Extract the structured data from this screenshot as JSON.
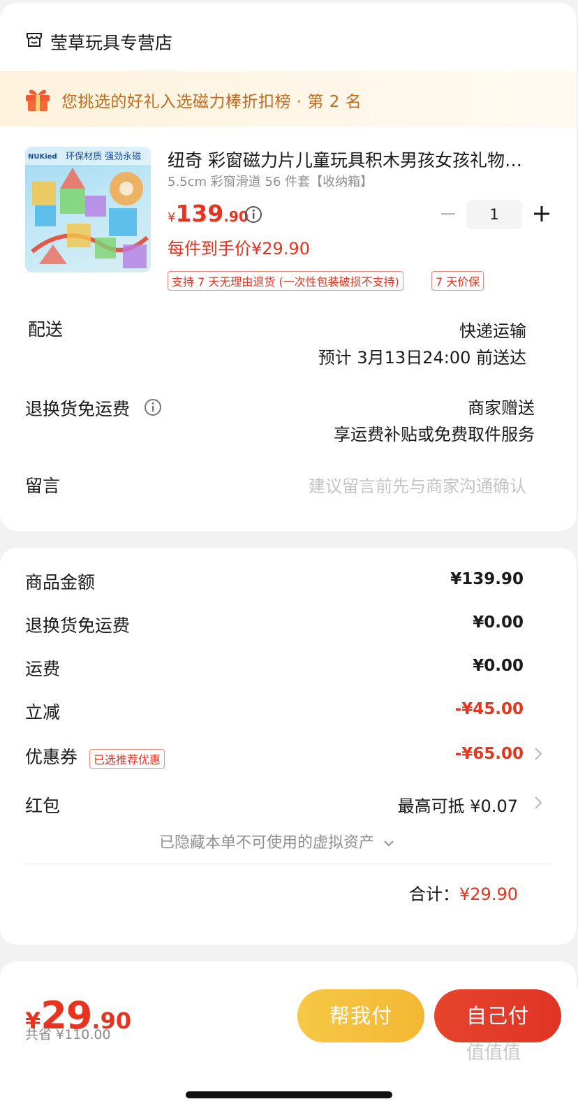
{
  "store": {
    "name": "莹草玩具专营店",
    "icon": "store-icon"
  },
  "rank_banner": {
    "text": "您挑选的好礼入选磁力棒折扣榜 · 第 2 名",
    "icon": "gift-icon"
  },
  "product": {
    "image_badge": "环保材质 强劲永磁",
    "image_logo": "NUKied",
    "title": "纽奇 彩窗磁力片儿童玩具积木男孩女孩礼物…",
    "spec": "5.5cm 彩窗滑道 56 件套【收纳箱】",
    "price_symbol": "¥",
    "price_int": "139",
    "price_dec": ".90",
    "quantity": "1",
    "deal_price": "每件到手价¥29.90",
    "tags": [
      "支持 7 天无理由退货 (一次性包装破损不支持)",
      "7 天价保"
    ]
  },
  "delivery": {
    "label": "配送",
    "method": "快递运输",
    "eta": "预计 3月13日24:00 前送达"
  },
  "return_shipping": {
    "label": "退换货免运费",
    "value": "商家赠送",
    "sub": "享运费补贴或免费取件服务"
  },
  "message": {
    "label": "留言",
    "placeholder": "建议留言前先与商家沟通确认"
  },
  "summary": {
    "goods": {
      "label": "商品金额",
      "value": "¥139.90"
    },
    "return_fee": {
      "label": "退换货免运费",
      "value": "¥0.00"
    },
    "shipping": {
      "label": "运费",
      "value": "¥0.00"
    },
    "discount": {
      "label": "立减",
      "value": "-¥45.00"
    },
    "coupon": {
      "label": "优惠券",
      "tag": "已选推荐优惠",
      "value": "-¥65.00"
    },
    "redpacket": {
      "label": "红包",
      "value": "最高可抵 ¥0.07"
    },
    "hidden_assets": "已隐藏本单不可使用的虚拟资产",
    "total_label": "合计：",
    "total_value": "¥29.90"
  },
  "bottom": {
    "price_symbol": "¥",
    "price_int": "29",
    "price_dec": ".90",
    "saved": "共省 ¥110.00",
    "help_pay": "帮我付",
    "self_pay": "自己付",
    "watermark": "值值值"
  },
  "colors": {
    "accent_red": "#e8331e",
    "banner_text": "#c36a1e",
    "help_button": "#f3b834",
    "pay_button": "#e03425"
  }
}
